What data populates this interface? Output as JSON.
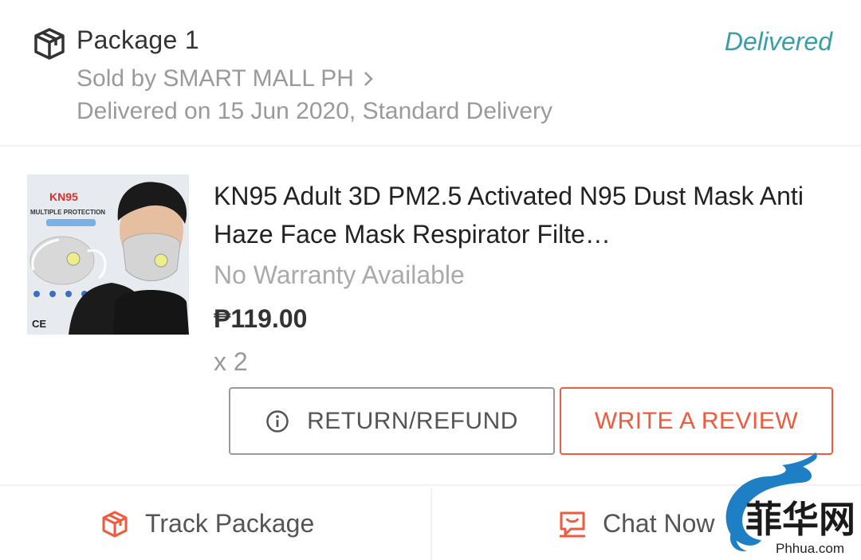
{
  "package": {
    "title": "Package 1",
    "status": "Delivered",
    "seller": "Sold by SMART MALL PH",
    "delivery": "Delivered on 15 Jun 2020, Standard Delivery"
  },
  "product": {
    "title": "KN95 Adult 3D PM2.5 Activated N95 Dust Mask Anti Haze Face Mask Respirator Filte…",
    "warranty": "No Warranty Available",
    "price": "₱119.00",
    "quantity": "x 2",
    "thumbnail": {
      "brand": "KN95",
      "subtitle": "MULTIPLE PROTECTION",
      "mark": "CE"
    }
  },
  "actions": {
    "return_label": "RETURN/REFUND",
    "review_label": "WRITE A REVIEW"
  },
  "footer": {
    "track_label": "Track Package",
    "chat_label": "Chat Now"
  },
  "watermark": {
    "chars": "菲华网",
    "site": "Phhua.com"
  },
  "colors": {
    "accent": "#f05a3e",
    "status": "#3a9ea5",
    "muted": "#9a9a9a"
  }
}
